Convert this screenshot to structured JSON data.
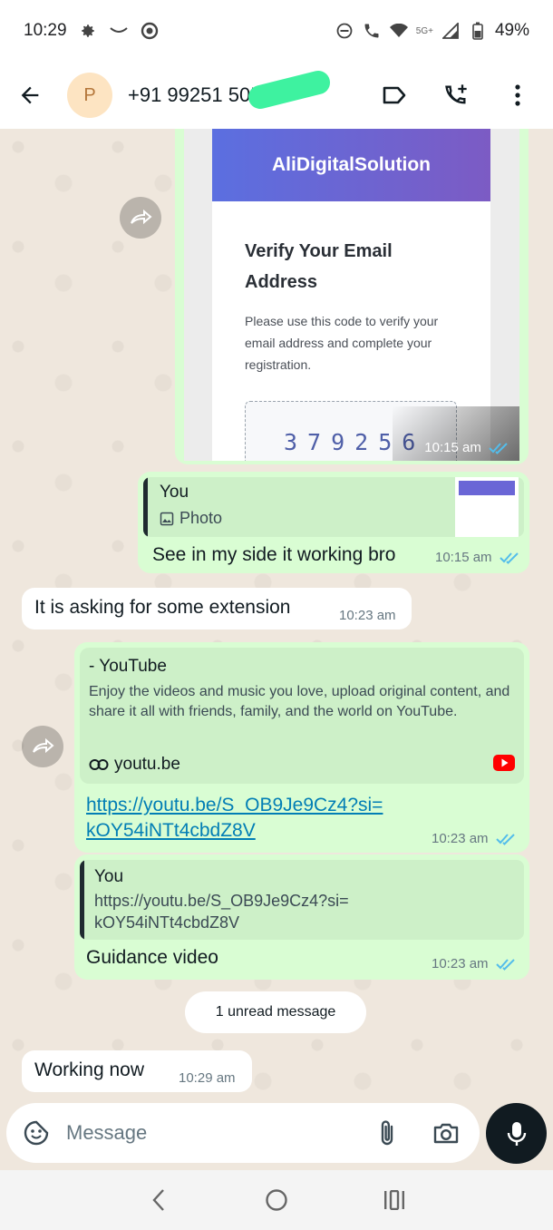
{
  "status_bar": {
    "time": "10:29",
    "network": "5G+",
    "battery": "49%"
  },
  "header": {
    "avatar_letter": "P",
    "contact_name": "+91 99251 505"
  },
  "messages": {
    "email_card": {
      "brand": "AliDigitalSolution",
      "title": "Verify Your Email Address",
      "body": "Please use this code to verify your email address and complete your registration.",
      "code": "379256",
      "time": "10:15 am"
    },
    "reply_photo": {
      "quote_author": "You",
      "quote_type": "Photo",
      "text": "See in my side it working bro",
      "time": "10:15 am"
    },
    "incoming_1": {
      "text": "It is asking for some extension",
      "time": "10:23 am"
    },
    "youtube_link": {
      "preview_title": "- YouTube",
      "preview_desc": "Enjoy the videos and music you love, upload original content, and share it all with friends, family, and the world on YouTube.",
      "domain": "youtu.be",
      "url_line1": "https://youtu.be/S_OB9Je9Cz4?si=",
      "url_line2": "kOY54iNTt4cbdZ8V",
      "time": "10:23 am"
    },
    "reply_link": {
      "quote_author": "You",
      "quote_line1": "https://youtu.be/S_OB9Je9Cz4?si=",
      "quote_line2": "kOY54iNTt4cbdZ8V",
      "text": "Guidance video",
      "time": "10:23 am"
    },
    "unread_divider": "1 unread message",
    "incoming_2": {
      "text": "Working now",
      "time": "10:29 am"
    }
  },
  "composer": {
    "placeholder": "Message"
  },
  "colors": {
    "outgoing_bubble": "#d9fdd3",
    "incoming_bubble": "#ffffff",
    "read_ticks": "#53bdeb",
    "chat_bg": "#efe7dd",
    "link": "#027eb5"
  }
}
